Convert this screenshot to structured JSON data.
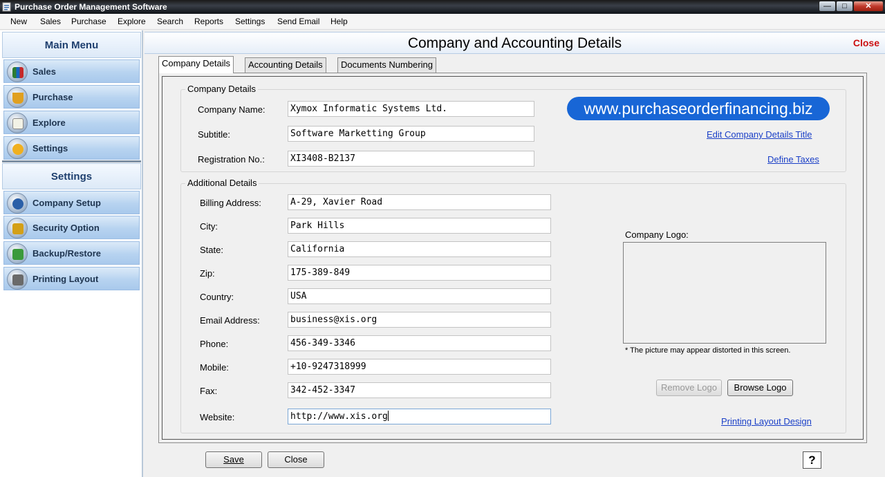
{
  "window": {
    "title": "Purchase Order Management Software",
    "icon": "app-icon"
  },
  "menu": [
    "New",
    "Sales",
    "Purchase",
    "Explore",
    "Search",
    "Reports",
    "Settings",
    "Send Email",
    "Help"
  ],
  "sidebar": {
    "main_menu_title": "Main Menu",
    "main_items": [
      {
        "label": "Sales",
        "icon": "sales-chart-icon"
      },
      {
        "label": "Purchase",
        "icon": "purchase-basket-icon"
      },
      {
        "label": "Explore",
        "icon": "explore-icon"
      },
      {
        "label": "Settings",
        "icon": "settings-gear-icon"
      }
    ],
    "settings_title": "Settings",
    "settings_items": [
      {
        "label": "Company Setup",
        "icon": "company-setup-icon"
      },
      {
        "label": "Security Option",
        "icon": "lock-icon"
      },
      {
        "label": "Backup/Restore",
        "icon": "backup-icon"
      },
      {
        "label": "Printing Layout",
        "icon": "printer-icon"
      }
    ]
  },
  "header": {
    "title": "Company and Accounting Details",
    "close_label": "Close"
  },
  "tabs": [
    "Company Details",
    "Accounting Details",
    "Documents Numbering"
  ],
  "company_details": {
    "legend": "Company Details",
    "company_name_label": "Company Name:",
    "company_name": "Xymox Informatic Systems Ltd.",
    "subtitle_label": "Subtitle:",
    "subtitle": "Software Marketting Group",
    "registration_label": "Registration No.:",
    "registration": "XI3408-B2137",
    "url_badge": "www.purchaseorderfinancing.biz",
    "edit_title_link": "Edit Company Details Title",
    "define_taxes_link": "Define Taxes"
  },
  "additional_details": {
    "legend": "Additional Details",
    "billing_address_label": "Billing Address:",
    "billing_address": "A-29, Xavier Road",
    "city_label": "City:",
    "city": "Park Hills",
    "state_label": "State:",
    "state": "California",
    "zip_label": "Zip:",
    "zip": "175-389-849",
    "country_label": "Country:",
    "country": "USA",
    "email_label": "Email Address:",
    "email": "business@xis.org",
    "phone_label": "Phone:",
    "phone": "456-349-3346",
    "mobile_label": "Mobile:",
    "mobile": "+10-9247318999",
    "fax_label": "Fax:",
    "fax": "342-452-3347",
    "website_label": "Website:",
    "website": "http://www.xis.org",
    "logo_label": "Company Logo:",
    "logo_note": "* The picture may appear distorted in this screen.",
    "remove_logo": "Remove Logo",
    "browse_logo": "Browse Logo",
    "printing_layout_link": "Printing Layout Design"
  },
  "footer": {
    "save_label": "Save",
    "close_label": "Close",
    "help_icon": "?"
  }
}
